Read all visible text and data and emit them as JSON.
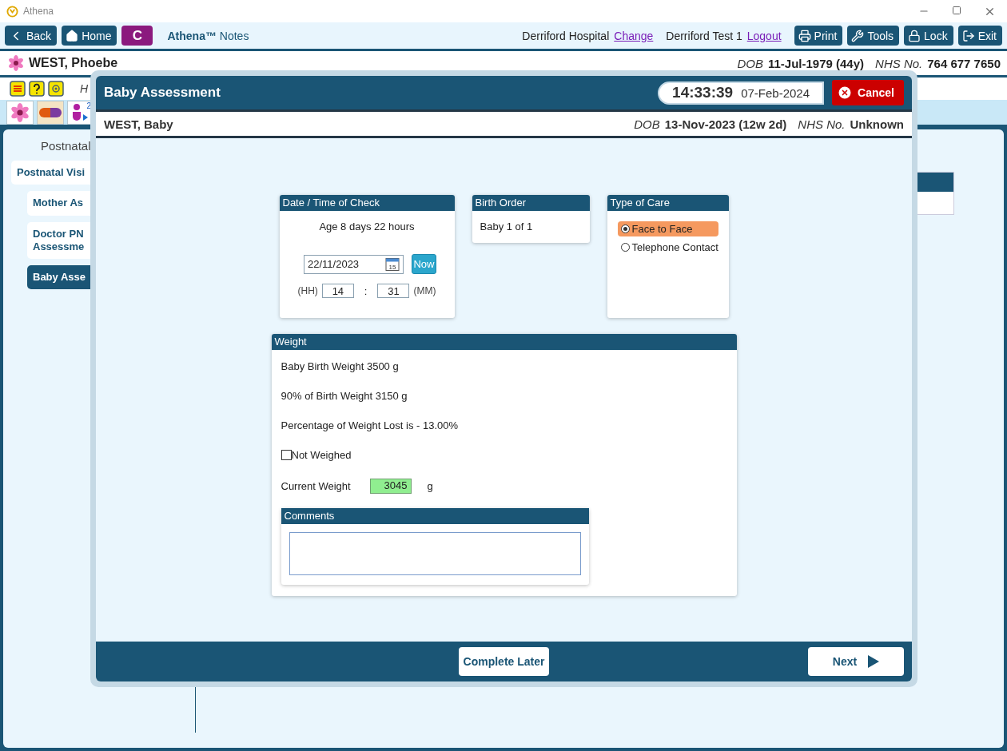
{
  "window": {
    "title": "Athena"
  },
  "toolbar": {
    "nav_buttons": [
      "Back",
      "Home"
    ],
    "app_badge": "C",
    "app_name": "Athena™",
    "app_subtitle": "Notes",
    "site": "Derriford Hospital",
    "site_link": "Change",
    "user": "Derriford Test 1",
    "user_link": "Logout",
    "action_buttons": [
      "Print",
      "Tools",
      "Lock",
      "Exit"
    ]
  },
  "patient": {
    "name": "WEST, Phoebe",
    "dob_label": "DOB",
    "dob": "11-Jul-1979 (44y)",
    "nhs_label": "NHS No.",
    "nhs": "764 677 7650"
  },
  "alert_row": {
    "text": "H"
  },
  "icon_row": {
    "badge_count": "2"
  },
  "sidebar": {
    "heading": "Postnatal",
    "items": [
      {
        "label": "Postnatal Visi",
        "selected": false,
        "children": [
          {
            "label": "Mother As",
            "selected": false
          },
          {
            "label": "Doctor PN\nAssessme",
            "selected": false
          },
          {
            "label": "Baby Asse",
            "selected": true
          }
        ]
      }
    ]
  },
  "modal": {
    "title": "Baby Assessment",
    "time": "14:33:39",
    "date": "07-Feb-2024",
    "cancel": "Cancel",
    "baby": {
      "name": "WEST, Baby",
      "dob_label": "DOB",
      "dob": "13-Nov-2023 (12w 2d)",
      "nhs_label": "NHS No.",
      "nhs": "Unknown"
    },
    "date_time": {
      "title": "Date / Time of Check",
      "age": "Age 8 days 22 hours",
      "date": "22/11/2023",
      "calendar_day": "15",
      "now": "Now",
      "hh_label": "(HH)",
      "hh": "14",
      "separator": ":",
      "mm": "31",
      "mm_label": "(MM)"
    },
    "birth_order": {
      "title": "Birth Order",
      "value": "Baby 1 of 1"
    },
    "type_of_care": {
      "title": "Type of Care",
      "options": [
        {
          "label": "Face to Face",
          "selected": true
        },
        {
          "label": "Telephone Contact",
          "selected": false
        }
      ]
    },
    "weight": {
      "title": "Weight",
      "lines": [
        "Baby Birth Weight 3500 g",
        "90% of Birth Weight 3150 g",
        "Percentage of Weight Lost is - 13.00%"
      ],
      "not_weighed": {
        "label": "Not Weighed",
        "checked": false
      },
      "current": {
        "label": "Current Weight",
        "value": "3045",
        "unit": "g"
      },
      "comments": {
        "title": "Comments"
      }
    },
    "footer": {
      "complete_later": "Complete Later",
      "next": "Next"
    }
  }
}
